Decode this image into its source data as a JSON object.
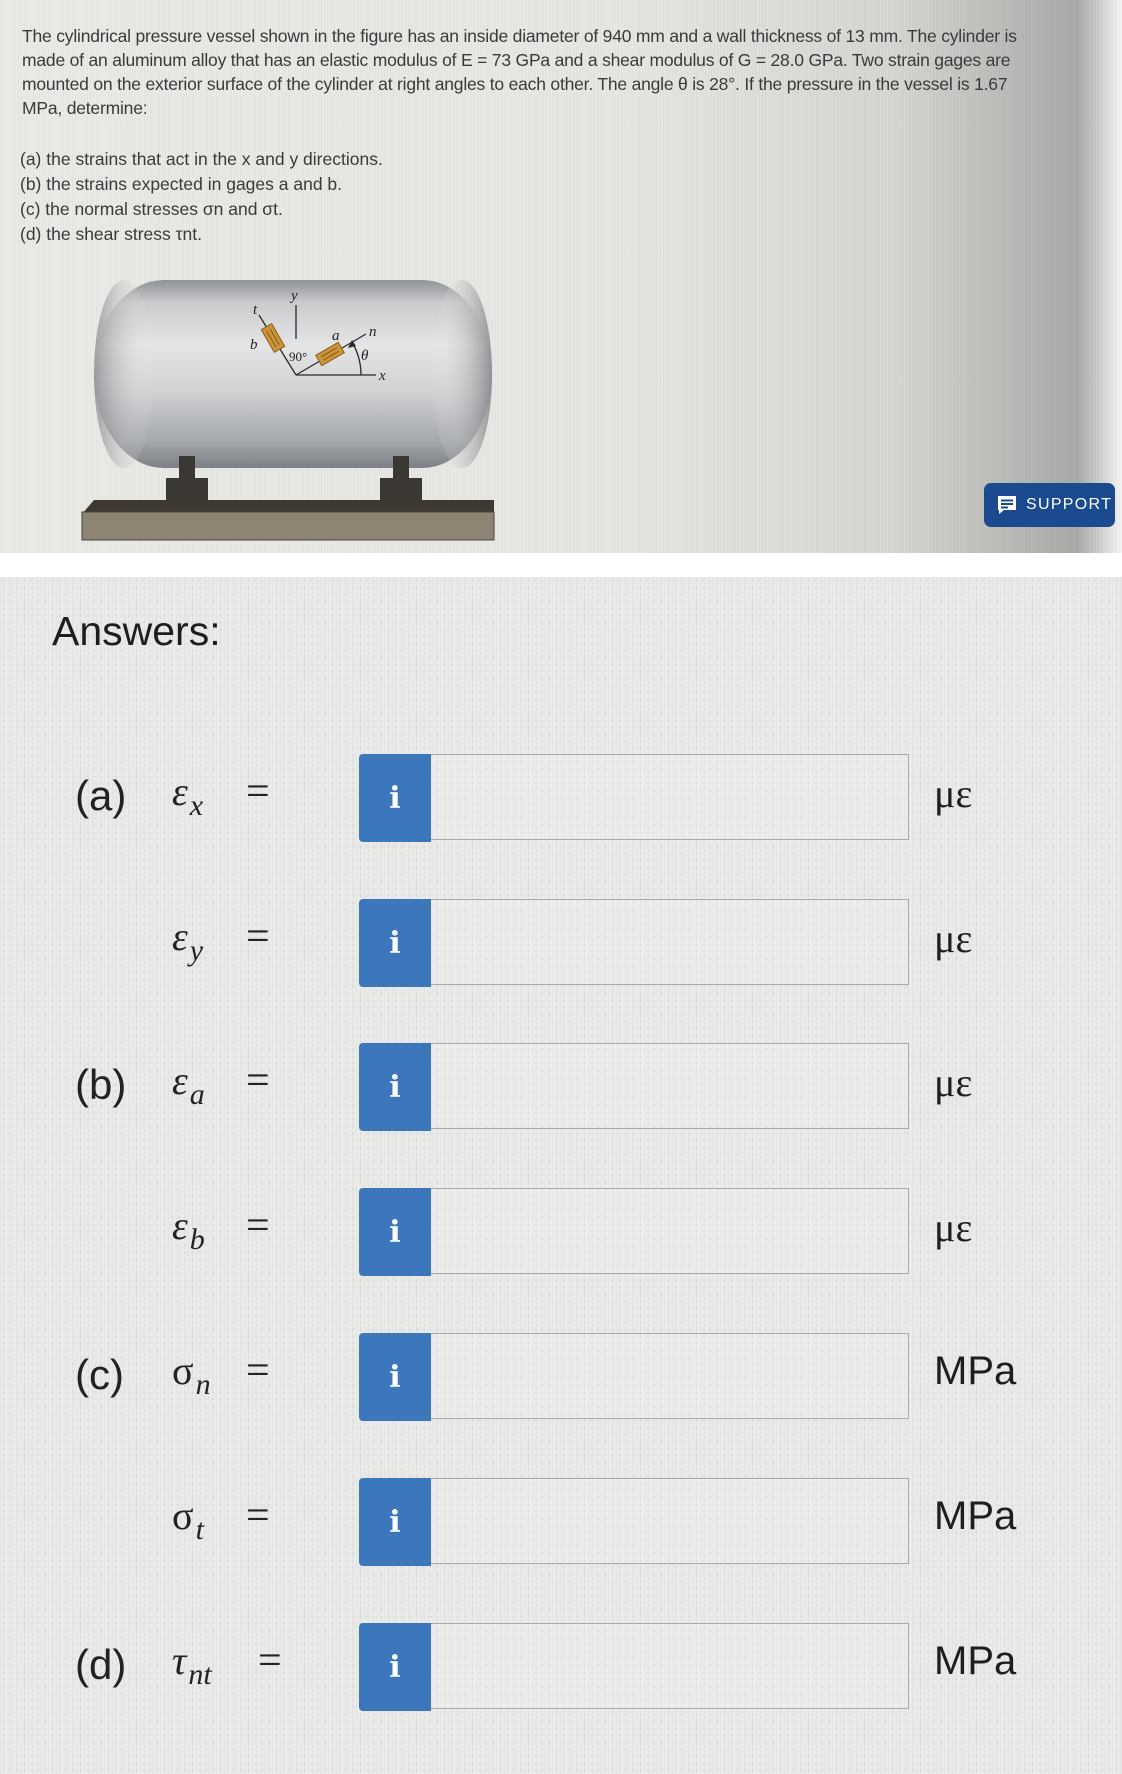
{
  "problem": {
    "statement_lines": [
      "The cylindrical pressure vessel shown in the figure has an inside diameter of 940 mm and a wall thickness of 13 mm.  The cylinder is",
      "made of an aluminum alloy that has an elastic modulus of E = 73 GPa and a shear modulus of G = 28.0 GPa.  Two strain gages are",
      "mounted on the exterior surface of the cylinder at right angles to each other.  The angle θ is 28°.  If the pressure in the vessel is 1.67",
      "MPa, determine:"
    ],
    "given": {
      "inside_diameter": "940 mm",
      "wall_thickness": "13 mm",
      "elastic_modulus": "E = 73 GPa",
      "shear_modulus": "G = 28.0 GPa",
      "angle": "θ = 28°",
      "pressure": "1.67 MPa"
    },
    "parts": [
      "(a) the strains that act in the x and y directions.",
      "(b) the strains expected in gages a and b.",
      "(c) the normal stresses σn and σt.",
      "(d) the shear stress τnt."
    ]
  },
  "figure": {
    "description": "Cylindrical pressure vessel on supports with two strain gages a and b at right angles",
    "labels": {
      "y": "y",
      "x": "x",
      "n": "n",
      "t": "t",
      "a": "a",
      "b": "b",
      "right_angle": "90°",
      "theta": "θ"
    },
    "colors": {
      "vessel": "#b9bcbf",
      "base_top": "#3c3833",
      "base_front": "#8e8474",
      "gage": "#c9943a"
    }
  },
  "support_button": {
    "label": "SUPPORT",
    "icon": "chat-bubble-icon",
    "color": "#1b4b8e"
  },
  "answers": {
    "title": "Answers:",
    "info_icon": "info-icon",
    "info_color": "#3c77bc",
    "rows": [
      {
        "part": "(a)",
        "symbol": "ε",
        "subscript": "x",
        "equals": "=",
        "value": "",
        "unit": "με"
      },
      {
        "part": "",
        "symbol": "ε",
        "subscript": "y",
        "equals": "=",
        "value": "",
        "unit": "με"
      },
      {
        "part": "(b)",
        "symbol": "ε",
        "subscript": "a",
        "equals": "=",
        "value": "",
        "unit": "με"
      },
      {
        "part": "",
        "symbol": "ε",
        "subscript": "b",
        "equals": "=",
        "value": "",
        "unit": "με"
      },
      {
        "part": "(c)",
        "symbol": "σ",
        "subscript": "n",
        "equals": "=",
        "value": "",
        "unit": "MPa"
      },
      {
        "part": "",
        "symbol": "σ",
        "subscript": "t",
        "equals": "=",
        "value": "",
        "unit": "MPa"
      },
      {
        "part": "(d)",
        "symbol": "τ",
        "subscript": "nt",
        "equals": "=",
        "value": "",
        "unit": "MPa"
      }
    ]
  }
}
